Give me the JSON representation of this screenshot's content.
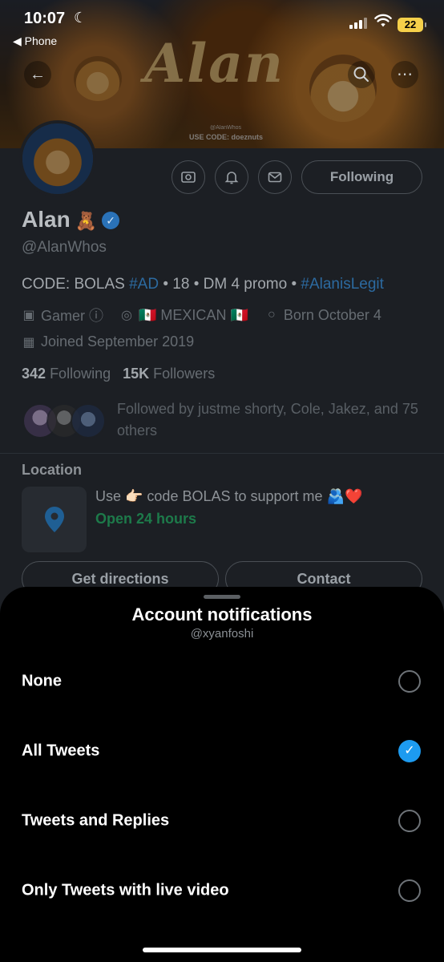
{
  "status_bar": {
    "time": "10:07",
    "back_app": "◀ Phone",
    "battery": "22"
  },
  "banner": {
    "title_art": "Alan",
    "handle_text": "@AlanWhos",
    "promo_text": "USE CODE: doeznuts"
  },
  "profile": {
    "name": "Alan",
    "name_emoji": "🧸",
    "handle": "@AlanWhos",
    "following_button": "Following",
    "bio": {
      "code": "CODE: BOLAS ",
      "tag1": "#AD",
      "middle": " • 18 • DM 4 promo • ",
      "tag2": "#AlanisLegit"
    },
    "category": "Gamer ⓘ",
    "location": "🇲🇽 MEXICAN 🇲🇽",
    "birthday": "Born October 4",
    "joined": "Joined September 2019",
    "following_count": "342",
    "following_label": "Following",
    "followers_count": "15K",
    "followers_label": "Followers",
    "followed_by": "Followed by justme shorty, Cole, Jakez, and 75 others"
  },
  "location_section": {
    "label": "Location",
    "description": "Use 👉🏻 code BOLAS to support me 🫂❤️",
    "hours": "Open 24 hours",
    "directions_button": "Get directions",
    "contact_button": "Contact"
  },
  "sheet": {
    "title": "Account notifications",
    "subtitle": "@xyanfoshi",
    "options": [
      {
        "label": "None",
        "selected": false
      },
      {
        "label": "All Tweets",
        "selected": true
      },
      {
        "label": "Tweets and Replies",
        "selected": false
      },
      {
        "label": "Only Tweets with live video",
        "selected": false
      }
    ]
  },
  "colors": {
    "accent": "#1d9bf0",
    "sheet_bg": "#000000",
    "dim_background": "#1c1f24"
  }
}
